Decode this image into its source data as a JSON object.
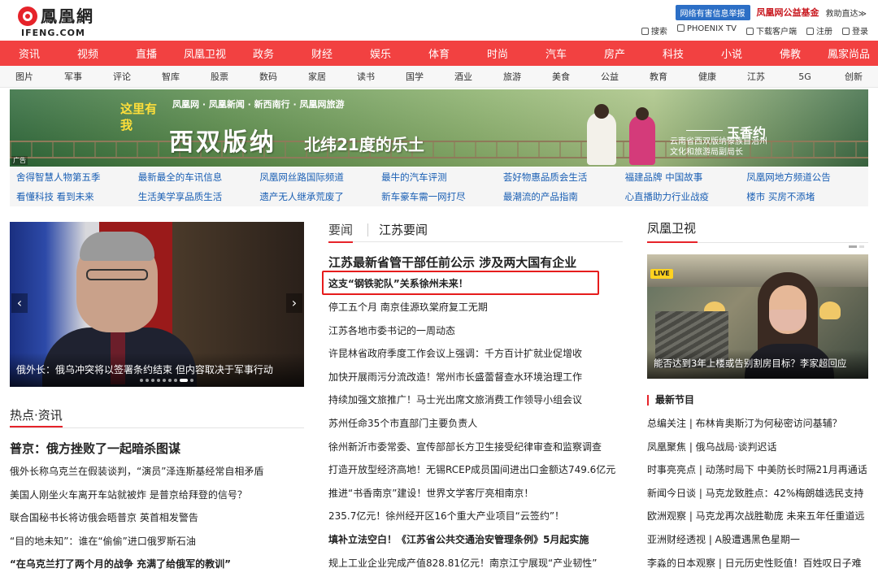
{
  "header": {
    "logo_cn": "鳳凰網",
    "logo_en": "IFENG.COM",
    "report_button": "网络有害信息举报",
    "charity": "凤凰网公益基金",
    "sos": "救助直达≫",
    "util_links": [
      "搜索",
      "PHOENIX TV",
      "下载客户端",
      "注册",
      "登录"
    ]
  },
  "nav_main": [
    "资讯",
    "视频",
    "直播",
    "凤凰卫视",
    "政务",
    "财经",
    "娱乐",
    "体育",
    "时尚",
    "汽车",
    "房产",
    "科技",
    "小说",
    "佛教",
    "鳳家尚品"
  ],
  "nav_sub": [
    "图片",
    "军事",
    "评论",
    "智库",
    "股票",
    "数码",
    "家居",
    "读书",
    "国学",
    "酒业",
    "旅游",
    "美食",
    "公益",
    "教育",
    "健康",
    "江苏",
    "5G",
    "创新"
  ],
  "banner": {
    "tag_line": "凤凰网 · 凤凰新闻 · 新西南行 · 凤凰网旅游",
    "seal": "这里有我",
    "title1": "西双版纳",
    "title2": "北纬21度的乐土",
    "person_name": "玉香约",
    "person_title_1": "云南省西双版纳傣族自治州",
    "person_title_2": "文化和旅游局副局长",
    "ad_label": "广告"
  },
  "link_grid": [
    "舍得智慧人物第五季",
    "最新最全的车讯信息",
    "凤凰网丝路国际频道",
    "最牛的汽车评测",
    "荟好物惠品质会生活",
    "福建品牌 中国故事",
    "凤凰网地方频道公告",
    "看懂科技 看到未来",
    "生活美学享品质生活",
    "遗产无人继承荒废了",
    "新车豪车需一网打尽",
    "最潮流的产品指南",
    "心直播助力行业战疫",
    "楼市 买房不添堵"
  ],
  "slideshow": {
    "caption": "俄外长：俄乌冲突将以签署条约结束 但内容取决于军事行动",
    "prev": "‹",
    "next": "›"
  },
  "hot": {
    "title": "热点·资讯",
    "headline": "普京：俄方挫败了一起暗杀图谋",
    "items": [
      {
        "text": "俄外长称乌克兰在假装谈判，“演员”泽连斯基经常自相矛盾",
        "bold": false
      },
      {
        "text": "美国人刚坐火车离开车站就被炸 是普京给拜登的信号？",
        "bold": false
      },
      {
        "text": "联合国秘书长将访俄会晤普京 英首相发警告",
        "bold": false
      },
      {
        "text": "“目的地未知”：谁在“偷偷”进口俄罗斯石油",
        "bold": false
      },
      {
        "text": "“在乌克兰打了两个月的战争 充满了给俄军的教训”",
        "bold": true
      }
    ]
  },
  "news": {
    "tab_active": "要闻",
    "tab_other": "江苏要闻",
    "headline": "江苏最新省管干部任前公示 涉及两大国有企业",
    "highlighted": "这支“钢铁驼队”关系徐州未来！",
    "items": [
      {
        "text": "停工五个月 南京佳源玖棠府复工无期",
        "bold": false
      },
      {
        "text": "江苏各地市委书记的一周动态",
        "bold": false
      },
      {
        "text": "许昆林省政府季度工作会议上强调：千方百计扩就业促增收",
        "bold": false
      },
      {
        "text": "加快开展雨污分流改造！常州市长盛蕾督查水环境治理工作",
        "bold": false
      },
      {
        "text": "持续加强文旅推广！马士光出席文旅消费工作领导小组会议",
        "bold": false
      },
      {
        "text": "苏州任命35个市直部门主要负责人",
        "bold": false
      },
      {
        "text": "徐州新沂市委常委、宣传部部长方卫生接受纪律审查和监察调查",
        "bold": false
      },
      {
        "text": "打造开放型经济高地！无锡RCEP成员国间进出口金额达749.6亿元",
        "bold": false
      },
      {
        "text": "推进“书香南京”建设！世界文学客厅亮相南京！",
        "bold": false
      },
      {
        "text": "235.7亿元！徐州经开区16个重大产业项目“云签约”！",
        "bold": false
      },
      {
        "text": "填补立法空白！《江苏省公共交通治安管理条例》5月起实施",
        "bold": true
      },
      {
        "text": "规上工业企业完成产值828.81亿元！南京江宁展现“产业韧性”",
        "bold": false
      }
    ]
  },
  "tv": {
    "title": "凤凰卫视",
    "live_label": "LIVE",
    "caption": "能否达到3年上楼或告别割房目标？李家超回应",
    "latest_title": "最新节目",
    "items": [
      "总编关注 | 布林肯奥斯汀为何秘密访问基辅？",
      "凤凰聚焦 | 俄乌战局·谈判迟话",
      "时事亮亮点 | 动荡时局下 中美防长时隔21月再通话",
      "新闻今日谈 | 马克龙致胜点：42%梅朗雄选民支持",
      "欧洲观察 | 马克龙再次战胜勒庞 未来五年任重道远",
      "亚洲财经透视 | A股遭遇黑色星期一",
      "李淼的日本观察 | 日元历史性贬值！百姓叹日子难"
    ]
  },
  "colors": {
    "nav_red": "#f24141",
    "brand_red": "#e6232a",
    "link_blue": "#1a5fb4",
    "highlight_border": "#e61c1c"
  }
}
